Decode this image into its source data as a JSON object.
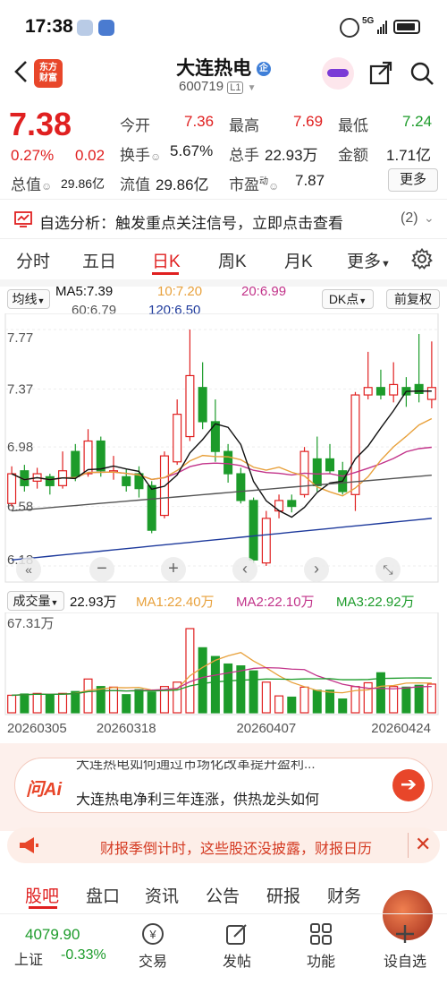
{
  "status_bar": {
    "time": "17:38",
    "signal": "5G"
  },
  "header": {
    "brand": "东方\n财富",
    "title": "大连热电",
    "code": "600719",
    "market_badge": "L1",
    "category_icon": "企"
  },
  "quote": {
    "price": "7.38",
    "change_pct": "0.27%",
    "change_amt": "0.02",
    "open_label": "今开",
    "open": "7.36",
    "high_label": "最高",
    "high": "7.69",
    "low_label": "最低",
    "low": "7.24",
    "turnover_label": "换手",
    "turnover": "5.67%",
    "volume_label": "总手",
    "volume": "22.93万",
    "amount_label": "金额",
    "amount": "1.71亿",
    "total_cap_label": "总值",
    "total_cap": "29.86亿",
    "float_cap_label": "流值",
    "float_cap": "29.86亿",
    "pe_label": "市盈",
    "pe_sup": "动",
    "pe": "7.87",
    "more_button": "更多"
  },
  "analysis_bar": {
    "text": "自选分析：触发重点关注信号，立即点击查看",
    "count": "(2)"
  },
  "tabs": [
    "分时",
    "五日",
    "日K",
    "周K",
    "月K",
    "更多"
  ],
  "ma_line": {
    "toggle": "均线",
    "ma5": "MA5:7.39",
    "ma10": "10:7.20",
    "ma20": "20:6.99",
    "ma60": "60:6.79",
    "ma120": "120:6.50",
    "dk_button": "DK点",
    "adjust_button": "前复权"
  },
  "volume_line": {
    "toggle": "成交量",
    "vol": "22.93万",
    "ma1": "MA1:22.40万",
    "ma2": "MA2:22.10万",
    "ma3": "MA3:22.92万",
    "max_label": "67.31万"
  },
  "colors": {
    "up": "#e02020",
    "down": "#1c9b2a",
    "ma5": "#111111",
    "ma10": "#e8a13c",
    "ma20": "#c2338a",
    "ma60": "#555555",
    "ma120": "#1e3a9c"
  },
  "chart_data": {
    "type": "candlestick",
    "y_ticks": [
      "7.77",
      "7.37",
      "6.98",
      "6.58",
      "6.18"
    ],
    "ylim": [
      6.18,
      7.77
    ],
    "x_labels": [
      "20260305",
      "20260318",
      "20260407",
      "20260424"
    ],
    "x_label_index": [
      0,
      9,
      20,
      31
    ],
    "candles": [
      {
        "o": 6.6,
        "c": 6.8,
        "h": 6.85,
        "l": 6.58
      },
      {
        "o": 6.82,
        "c": 6.72,
        "h": 6.86,
        "l": 6.68
      },
      {
        "o": 6.75,
        "c": 6.8,
        "h": 6.84,
        "l": 6.7
      },
      {
        "o": 6.78,
        "c": 6.72,
        "h": 6.8,
        "l": 6.66
      },
      {
        "o": 6.72,
        "c": 6.82,
        "h": 6.95,
        "l": 6.7
      },
      {
        "o": 6.95,
        "c": 6.78,
        "h": 7.0,
        "l": 6.75
      },
      {
        "o": 6.8,
        "c": 7.02,
        "h": 7.1,
        "l": 6.78
      },
      {
        "o": 7.02,
        "c": 6.82,
        "h": 7.05,
        "l": 6.78
      },
      {
        "o": 6.82,
        "c": 6.82,
        "h": 6.92,
        "l": 6.76
      },
      {
        "o": 6.78,
        "c": 6.72,
        "h": 6.83,
        "l": 6.68
      },
      {
        "o": 6.8,
        "c": 6.7,
        "h": 6.85,
        "l": 6.64
      },
      {
        "o": 6.72,
        "c": 6.42,
        "h": 6.75,
        "l": 6.4
      },
      {
        "o": 6.52,
        "c": 6.92,
        "h": 6.95,
        "l": 6.5
      },
      {
        "o": 6.88,
        "c": 7.2,
        "h": 7.3,
        "l": 6.86
      },
      {
        "o": 7.05,
        "c": 7.46,
        "h": 7.77,
        "l": 7.02
      },
      {
        "o": 7.38,
        "c": 7.15,
        "h": 7.55,
        "l": 7.1
      },
      {
        "o": 7.15,
        "c": 6.95,
        "h": 7.3,
        "l": 6.88
      },
      {
        "o": 6.95,
        "c": 6.8,
        "h": 7.0,
        "l": 6.74
      },
      {
        "o": 6.8,
        "c": 6.62,
        "h": 6.84,
        "l": 6.6
      },
      {
        "o": 6.62,
        "c": 6.22,
        "h": 6.64,
        "l": 6.2
      },
      {
        "o": 6.2,
        "c": 6.5,
        "h": 6.55,
        "l": 6.18
      },
      {
        "o": 6.55,
        "c": 6.62,
        "h": 6.66,
        "l": 6.5
      },
      {
        "o": 6.62,
        "c": 6.58,
        "h": 6.66,
        "l": 6.54
      },
      {
        "o": 6.66,
        "c": 6.95,
        "h": 6.98,
        "l": 6.64
      },
      {
        "o": 6.9,
        "c": 6.72,
        "h": 7.05,
        "l": 6.68
      },
      {
        "o": 6.9,
        "c": 6.82,
        "h": 7.0,
        "l": 6.8
      },
      {
        "o": 6.82,
        "c": 6.68,
        "h": 6.88,
        "l": 6.66
      },
      {
        "o": 6.66,
        "c": 7.33,
        "h": 7.35,
        "l": 6.55
      },
      {
        "o": 7.33,
        "c": 7.38,
        "h": 7.62,
        "l": 7.3
      },
      {
        "o": 7.38,
        "c": 7.33,
        "h": 7.5,
        "l": 7.3
      },
      {
        "o": 7.33,
        "c": 7.4,
        "h": 7.55,
        "l": 7.28
      },
      {
        "o": 7.38,
        "c": 7.33,
        "h": 7.45,
        "l": 7.25
      },
      {
        "o": 7.4,
        "c": 7.34,
        "h": 7.74,
        "l": 7.28
      },
      {
        "o": 7.3,
        "c": 7.38,
        "h": 7.69,
        "l": 7.24
      }
    ],
    "volume_ylim": [
      0,
      67.31
    ],
    "volume": [
      14.0,
      15.0,
      15.5,
      14.5,
      15.5,
      17.0,
      27.0,
      21.0,
      20.5,
      14.5,
      18.5,
      16.5,
      21.0,
      24.5,
      67.31,
      52.0,
      45.0,
      39.0,
      37.5,
      33.5,
      24.5,
      13.5,
      12.5,
      20.5,
      18.0,
      18.0,
      11.0,
      21.0,
      24.0,
      32.0,
      21.0,
      20.5,
      22.0,
      22.93
    ]
  },
  "ai_card": {
    "brand": "问Ai",
    "line1": "大连热电如何通过市场化改革提升盈利...",
    "line2": "大连热电净利三年连涨，供热龙头如何"
  },
  "notice_bar": {
    "text": "财报季倒计时，这些股还没披露，财报日历"
  },
  "bottom_tabs": [
    "股吧",
    "盘口",
    "资讯",
    "公告",
    "研报",
    "财务"
  ],
  "bottom_nav": {
    "index_value": "4079.90",
    "index_name": "上证",
    "index_change": "-0.33%",
    "items": [
      "交易",
      "发帖",
      "功能",
      "设自选"
    ]
  }
}
